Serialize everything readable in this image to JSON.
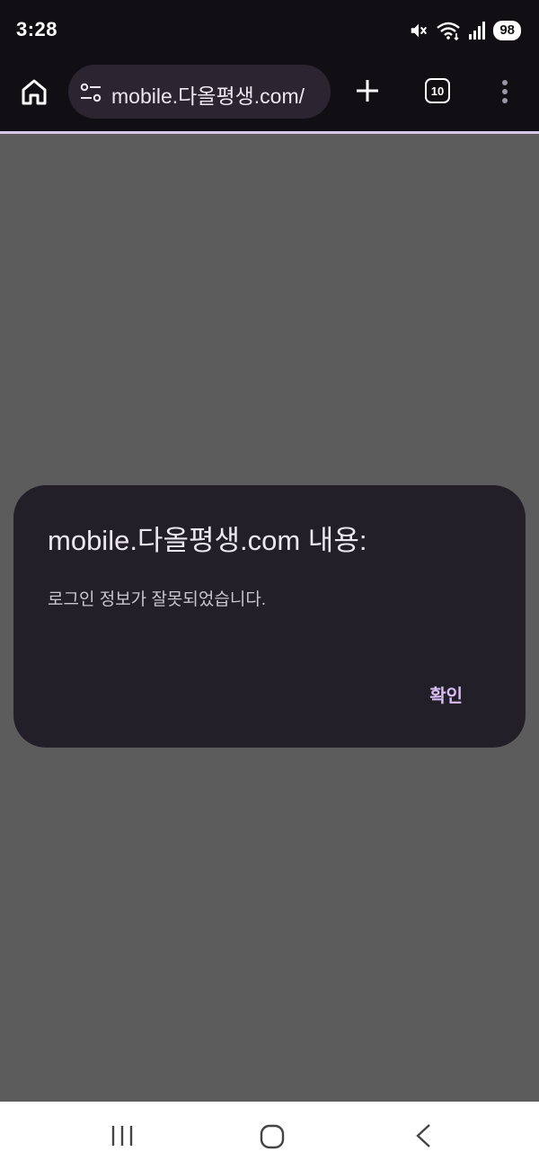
{
  "status_bar": {
    "time": "3:28",
    "battery": "98",
    "icons": [
      "mute-icon",
      "wifi-icon",
      "signal-icon",
      "battery-icon"
    ]
  },
  "toolbar": {
    "url": "mobile.다올평생.com/",
    "tab_count": "10",
    "icons": [
      "home-icon",
      "site-settings-icon",
      "plus-icon",
      "more-vert-icon"
    ]
  },
  "dialog": {
    "title": "mobile.다올평생.com 내용:",
    "message": "로그인 정보가 잘못되었습니다.",
    "confirm_label": "확인"
  },
  "nav_bar": {
    "icons": [
      "recents-icon",
      "home-circle-icon",
      "back-icon"
    ]
  },
  "colors": {
    "toolbar_bg": "#110f13",
    "url_bar_bg": "#2a2530",
    "dialog_bg": "#231f28",
    "accent": "#d8bdf3",
    "scrim": "#5c5c5c"
  }
}
